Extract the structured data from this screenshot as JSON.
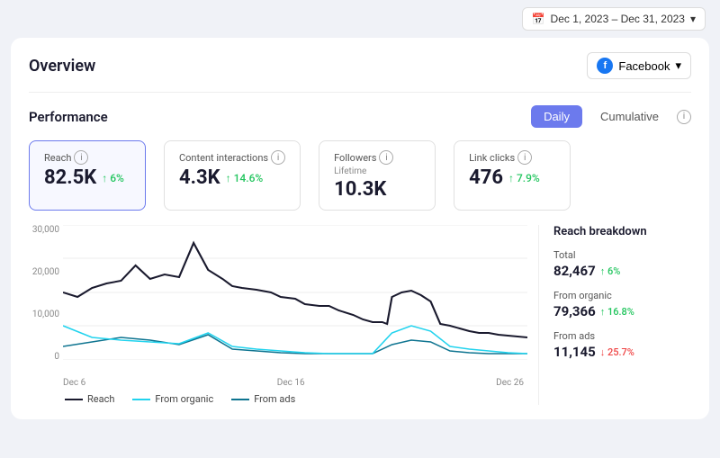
{
  "topbar": {
    "date_range": "Dec 1, 2023 – Dec 31, 2023"
  },
  "overview": {
    "title": "Overview",
    "platform": "Facebook",
    "platform_icon": "f"
  },
  "performance": {
    "title": "Performance",
    "tabs": [
      "Daily",
      "Cumulative"
    ],
    "active_tab": "Daily",
    "metrics": [
      {
        "label": "Reach",
        "value": "82.5K",
        "change": "6%",
        "direction": "up",
        "sublabel": ""
      },
      {
        "label": "Content interactions",
        "value": "4.3K",
        "change": "14.6%",
        "direction": "up",
        "sublabel": ""
      },
      {
        "label": "Followers",
        "value": "10.3K",
        "change": "",
        "direction": "",
        "sublabel": "Lifetime"
      },
      {
        "label": "Link clicks",
        "value": "476",
        "change": "7.9%",
        "direction": "up",
        "sublabel": ""
      }
    ]
  },
  "chart": {
    "y_labels": [
      "30,000",
      "20,000",
      "10,000",
      "0"
    ],
    "x_labels": [
      "Dec 6",
      "Dec 16",
      "Dec 26"
    ]
  },
  "legend": {
    "items": [
      {
        "label": "Reach",
        "color": "#1a1a2e"
      },
      {
        "label": "From organic",
        "color": "#22d3ee"
      },
      {
        "label": "From ads",
        "color": "#0e7490"
      }
    ]
  },
  "reach_breakdown": {
    "title": "Reach breakdown",
    "items": [
      {
        "label": "Total",
        "value": "82,467",
        "change": "6%",
        "direction": "up"
      },
      {
        "label": "From organic",
        "value": "79,366",
        "change": "16.8%",
        "direction": "up"
      },
      {
        "label": "From ads",
        "value": "11,145",
        "change": "25.7%",
        "direction": "down"
      }
    ]
  }
}
